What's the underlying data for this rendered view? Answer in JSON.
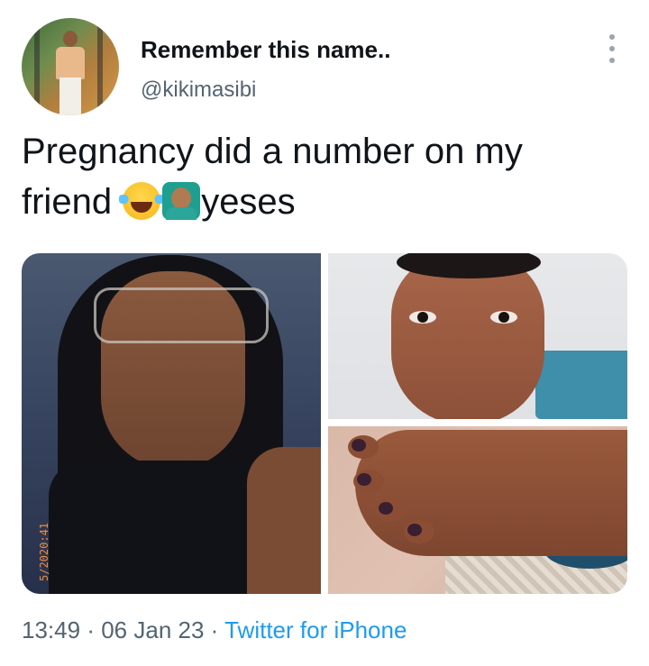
{
  "tweet": {
    "display_name": "Remember this name..",
    "handle": "@kikimasibi",
    "text_line1": "Pregnancy did a number on my",
    "text_word": "friend",
    "text_tail": "yeses",
    "emojis": [
      "face-with-tears-of-joy-icon",
      "person-gesturing-no-icon"
    ],
    "more_icon": "more-vertical-icon"
  },
  "photos": {
    "count": 3,
    "left_photo_stamp": "5/2020:41"
  },
  "meta": {
    "time": "13:49",
    "sep1": "·",
    "date": "06 Jan 23",
    "sep2": "·",
    "source": "Twitter for iPhone"
  },
  "colors": {
    "text_primary": "#0f1419",
    "text_secondary": "#536471",
    "link": "#1d9bf0"
  }
}
